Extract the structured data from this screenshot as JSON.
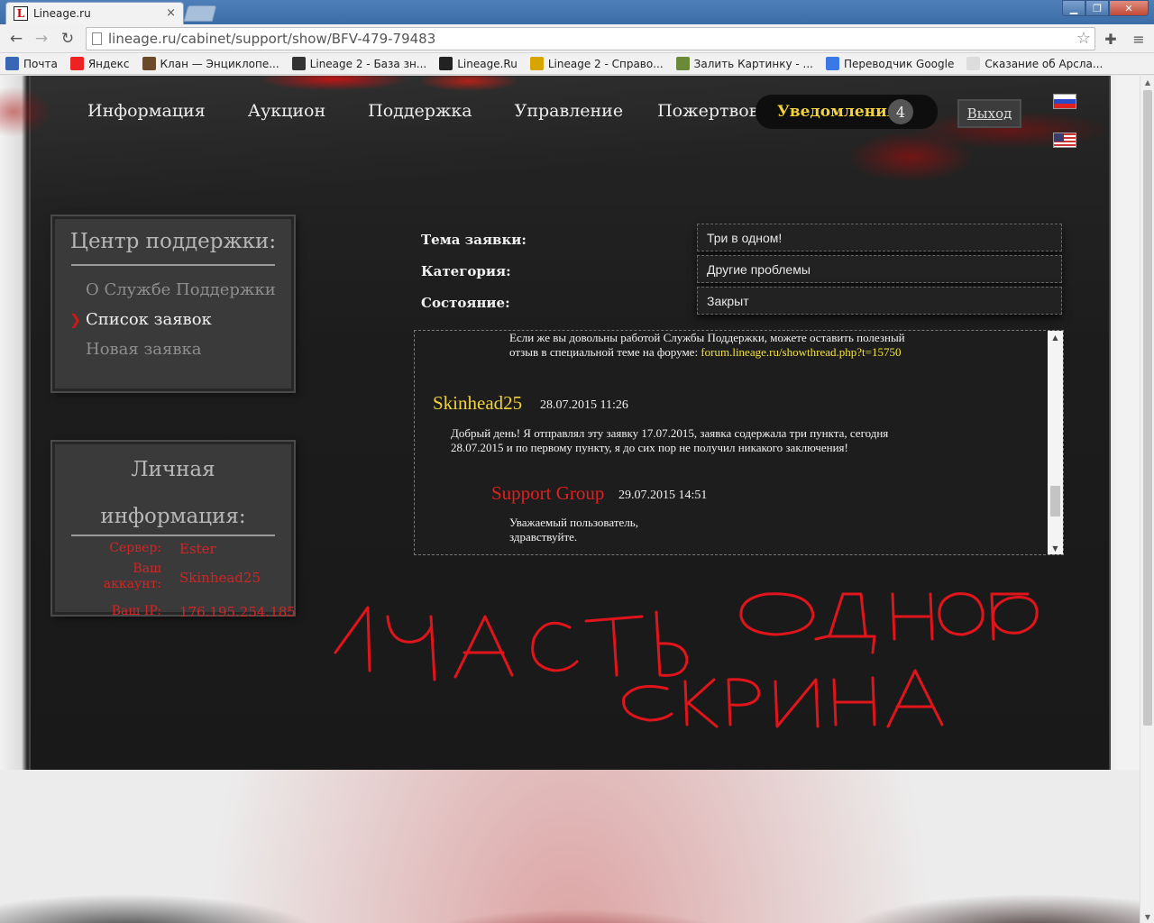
{
  "browser": {
    "tab_title": "Lineage.ru",
    "tab_favicon": "L",
    "url": "lineage.ru/cabinet/support/show/BFV-479-79483",
    "bookmarks": [
      {
        "label": "Почта",
        "icon_color": "#3a66b8",
        "icon": "mail-icon"
      },
      {
        "label": "Яндекс",
        "icon_color": "#e22",
        "icon": "yandex-icon"
      },
      {
        "label": "Клан — Энциклопе...",
        "icon_color": "#6b4a2a",
        "icon": "clan-icon"
      },
      {
        "label": "Lineage 2 - База зн...",
        "icon_color": "#333",
        "icon": "lineage-db-icon"
      },
      {
        "label": "Lineage.Ru",
        "icon_color": "#222",
        "icon": "lineage-icon"
      },
      {
        "label": "Lineage 2 - Справо...",
        "icon_color": "#d8a400",
        "icon": "guide-icon"
      },
      {
        "label": "Залить Картинку - ...",
        "icon_color": "#6a8a3a",
        "icon": "upload-icon"
      },
      {
        "label": "Переводчик Google",
        "icon_color": "#3b78e7",
        "icon": "translate-icon"
      },
      {
        "label": "Сказание об Арсла...",
        "icon_color": "#ddd",
        "icon": "page-icon"
      }
    ]
  },
  "nav": {
    "items": [
      "Информация",
      "Аукцион",
      "Поддержка",
      "Управление",
      "Пожертвование"
    ],
    "notifications_label": "Уведомления",
    "notifications_count": "4",
    "logout_label": "Выход"
  },
  "support_box": {
    "title": "Центр поддержки:",
    "items": [
      {
        "label": "О Службе Поддержки",
        "active": false
      },
      {
        "label": "Список заявок",
        "active": true
      },
      {
        "label": "Новая заявка",
        "active": false
      }
    ]
  },
  "info_box": {
    "title_line1": "Личная",
    "title_line2": "информация:",
    "server_label": "Сервер:",
    "server_value": "Ester",
    "account_label_1": "Ваш",
    "account_label_2": "аккаунт:",
    "account_value": "Skinhead25",
    "ip_label": "Ваш IP:",
    "ip_value": "176.195.254.185"
  },
  "ticket": {
    "subject_label": "Тема заявки:",
    "subject_value": "Три в одном!",
    "category_label": "Категория:",
    "category_value": "Другие проблемы",
    "status_label": "Состояние:",
    "status_value": "Закрыт"
  },
  "messages": {
    "intro_line1": "Если же вы довольны работой Службы Поддержки, можете оставить полезный",
    "intro_line2_prefix": "отзыв в специальной теме на форуме: ",
    "intro_link": "forum.lineage.ru/showthread.php?t=15750",
    "user_author": "Skinhead25",
    "user_date": "28.07.2015 11:26",
    "user_text_line1": "Добрый день! Я отправлял эту заявку 17.07.2015, заявка содержала три пункта, сегодня",
    "user_text_line2": "28.07.2015 и по первому пункту, я до сих пор не получил никакого заключения!",
    "support_author": "Support Group",
    "support_date": "29.07.2015 14:51",
    "support_text_line1": "Уважаемый пользователь,",
    "support_text_line2": "здравствуйте."
  },
  "colors": {
    "author_user": "#f0d23c",
    "author_support": "#e0201e",
    "handwriting": "#e0141b"
  }
}
